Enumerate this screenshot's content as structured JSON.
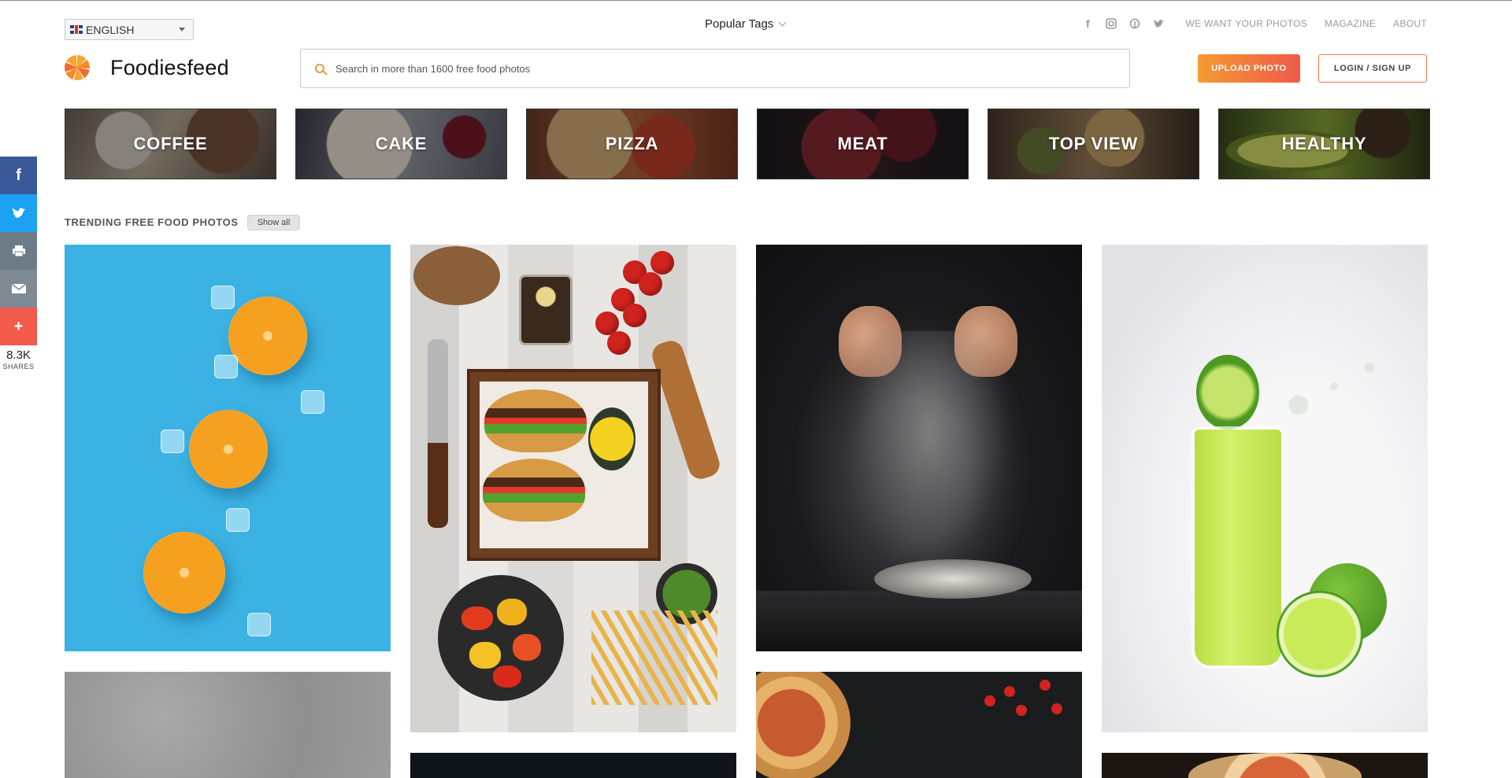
{
  "language": {
    "selected": "ENGLISH"
  },
  "header": {
    "popular_tags": "Popular Tags",
    "nav": [
      "WE WANT YOUR PHOTOS",
      "MAGAZINE",
      "ABOUT"
    ],
    "social_icons": [
      "facebook-icon",
      "instagram-icon",
      "pinterest-icon",
      "twitter-icon"
    ]
  },
  "brand": {
    "name": "Foodiesfeed"
  },
  "search": {
    "placeholder": "Search in more than 1600 free food photos"
  },
  "actions": {
    "upload": "UPLOAD PHOTO",
    "login": "LOGIN / SIGN UP"
  },
  "categories": [
    "COFFEE",
    "CAKE",
    "PIZZA",
    "MEAT",
    "TOP VIEW",
    "HEALTHY"
  ],
  "share": {
    "count": "8.3K",
    "label": "SHARES"
  },
  "trending": {
    "title": "TRENDING FREE FOOD PHOTOS",
    "show_all": "Show all"
  },
  "colors": {
    "accent_start": "#f59b32",
    "accent_end": "#ee5a4a",
    "facebook": "#3b5998",
    "twitter": "#1da1f2",
    "more": "#f25a4a"
  }
}
